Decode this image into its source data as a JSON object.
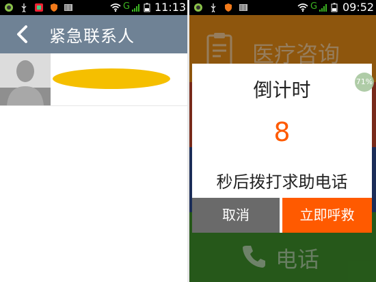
{
  "left_screen": {
    "status_bar": {
      "time": "11:13"
    },
    "header": {
      "title": "紧急联系人",
      "back_icon": "chevron-left-icon"
    },
    "contact": {
      "avatar_icon": "person-placeholder-icon"
    }
  },
  "right_screen": {
    "status_bar": {
      "time": "09:52"
    },
    "tiles": {
      "medical": {
        "label": "医疗咨询",
        "color": "#e58b16",
        "icon": "clipboard-icon"
      },
      "phone": {
        "label": "电话",
        "color": "#3e8f2a",
        "icon": "phone-icon"
      }
    },
    "dialog": {
      "title": "倒计时",
      "countdown": "8",
      "message": "秒后拨打求助电话",
      "cancel_label": "取消",
      "call_label": "立即呼救"
    },
    "memory_badge": "71%"
  }
}
